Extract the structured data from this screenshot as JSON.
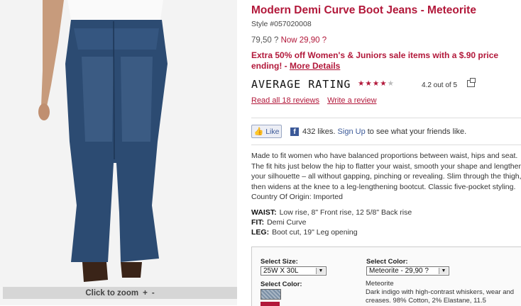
{
  "product": {
    "title": "Modern Demi Curve Boot Jeans - Meteorite",
    "style": "Style #057020008",
    "price_was": "79,50 ?",
    "price_now": "Now 29,90 ?",
    "promo_text": "Extra 50% off Women's & Juniors sale items with a $.90 price ending! -",
    "promo_link": "More Details"
  },
  "image": {
    "zoom_label": "Click to zoom",
    "zoom_in": "+",
    "zoom_out": "-"
  },
  "rating": {
    "heading": "AVERAGE RATING",
    "stars_filled": "★★★★",
    "stars_empty": "★",
    "value": 4.2,
    "text": "4.2 out of 5",
    "read_reviews": "Read all 18 reviews",
    "write_review": "Write a review"
  },
  "social": {
    "like_label": "Like",
    "thumb_icon": "👍",
    "fb_icon": "f",
    "likes_count": "432 likes.",
    "signup_link": "Sign Up",
    "signup_rest": "to see what your friends like."
  },
  "description": "Made to fit women who have balanced proportions between waist, hips and seat. The fit hits just below the hip to flatter your waist, smooth your shape and lengthen your silhouette – all without gapping, pinching or revealing. Slim through the thigh, then widens at the knee to a leg-lengthening bootcut. Classic five-pocket styling. Country Of Origin: Imported",
  "specs": {
    "waist_label": "WAIST:",
    "waist": "Low rise, 8\" Front rise, 12 5/8\" Back rise",
    "fit_label": "FIT:",
    "fit": "Demi Curve",
    "leg_label": "LEG:",
    "leg": "Boot cut, 19\" Leg opening"
  },
  "options": {
    "size_label": "Select Size:",
    "size_value": "25W X 30L",
    "color_label": "Select Color:",
    "color_value": "Meteorite - 29,90 ?",
    "swatch_label": "Select Color:",
    "color_name": "Meteorite",
    "color_desc": "Dark indigo with high-contrast whiskers, wear and creases. 98% Cotton, 2% Elastane, 11.5"
  },
  "colors": {
    "brand": "#b2183a",
    "facebook": "#3b5998"
  }
}
